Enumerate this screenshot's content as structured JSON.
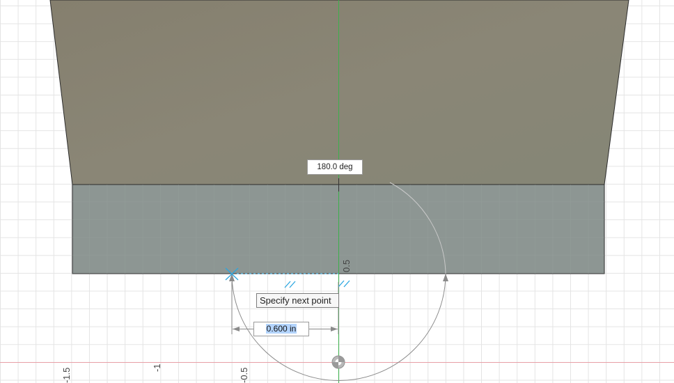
{
  "sketch": {
    "angle_readout": "180.0 deg",
    "tooltip": "Specify next point",
    "dimension_value": "0.600 in",
    "ruler_ticks": {
      "neg_1_5": "-1.5",
      "neg_1": "-1",
      "neg_0_5": "-0.5",
      "pos_0_5": "0.5"
    }
  },
  "colors": {
    "grid": "#e4e4e4",
    "body_top_face": "#8a8574",
    "body_front_face": "#8d9693",
    "x_axis": "#e8a0a8",
    "y_axis": "#3cb04b",
    "constraint_blue": "#2aa6e0",
    "dimension_line": "#8a8a8a"
  }
}
